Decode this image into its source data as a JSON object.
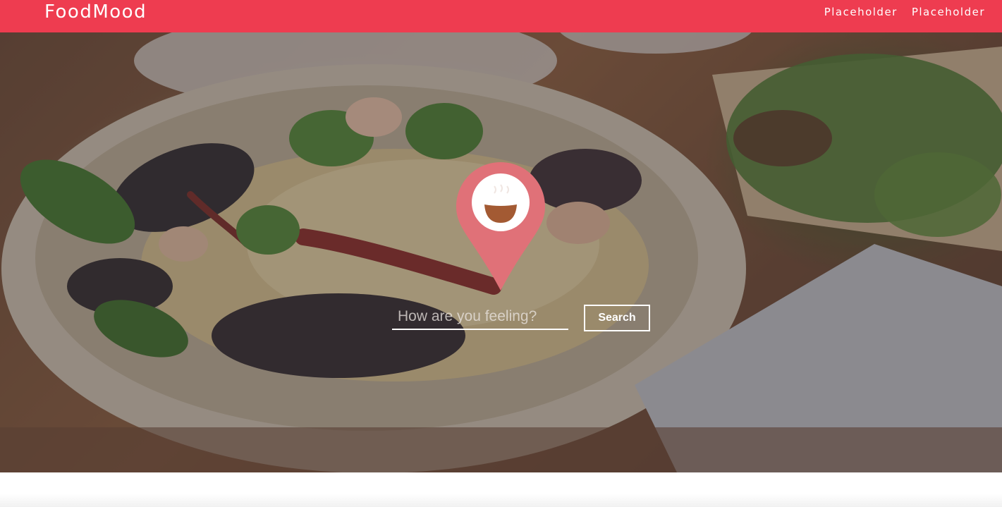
{
  "navbar": {
    "brand": "FoodMood",
    "links": [
      "Placeholder",
      "Placeholder"
    ],
    "background_color": "#ee3c50"
  },
  "hero": {
    "background": "food-photo",
    "logo_icon": "map-pin-smiling-bowl-icon",
    "pin_color": "#e07178",
    "search": {
      "placeholder": "How are you feeling?",
      "value": "",
      "button_label": "Search"
    }
  }
}
